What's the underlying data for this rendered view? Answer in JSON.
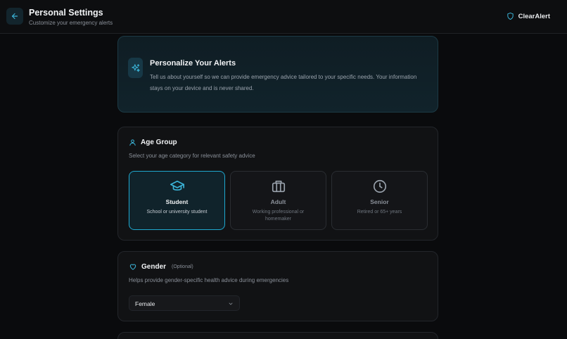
{
  "header": {
    "title": "Personal Settings",
    "subtitle": "Customize your emergency alerts",
    "brand": "ClearAlert",
    "back_icon": "arrow-left-icon",
    "brand_icon": "shield-icon"
  },
  "intro": {
    "icon": "sparkles-icon",
    "title": "Personalize Your Alerts",
    "text": "Tell us about yourself so we can provide emergency advice tailored to your specific needs. Your information stays on your device and is never shared."
  },
  "age_group": {
    "icon": "user-icon",
    "title": "Age Group",
    "description": "Select your age category for relevant safety advice",
    "selected": "Student",
    "options": [
      {
        "label": "Student",
        "description": "School or university student",
        "icon": "graduation-cap-icon"
      },
      {
        "label": "Adult",
        "description": "Working professional or homemaker",
        "icon": "briefcase-icon"
      },
      {
        "label": "Senior",
        "description": "Retired or 65+ years",
        "icon": "clock-icon"
      }
    ]
  },
  "gender": {
    "icon": "heart-icon",
    "title": "Gender",
    "optional": "(Optional)",
    "description": "Helps provide gender-specific health advice during emergencies",
    "value": "Female"
  },
  "colors": {
    "accent": "#1fa8cf",
    "background": "#0a0b0d",
    "card": "#111214"
  }
}
